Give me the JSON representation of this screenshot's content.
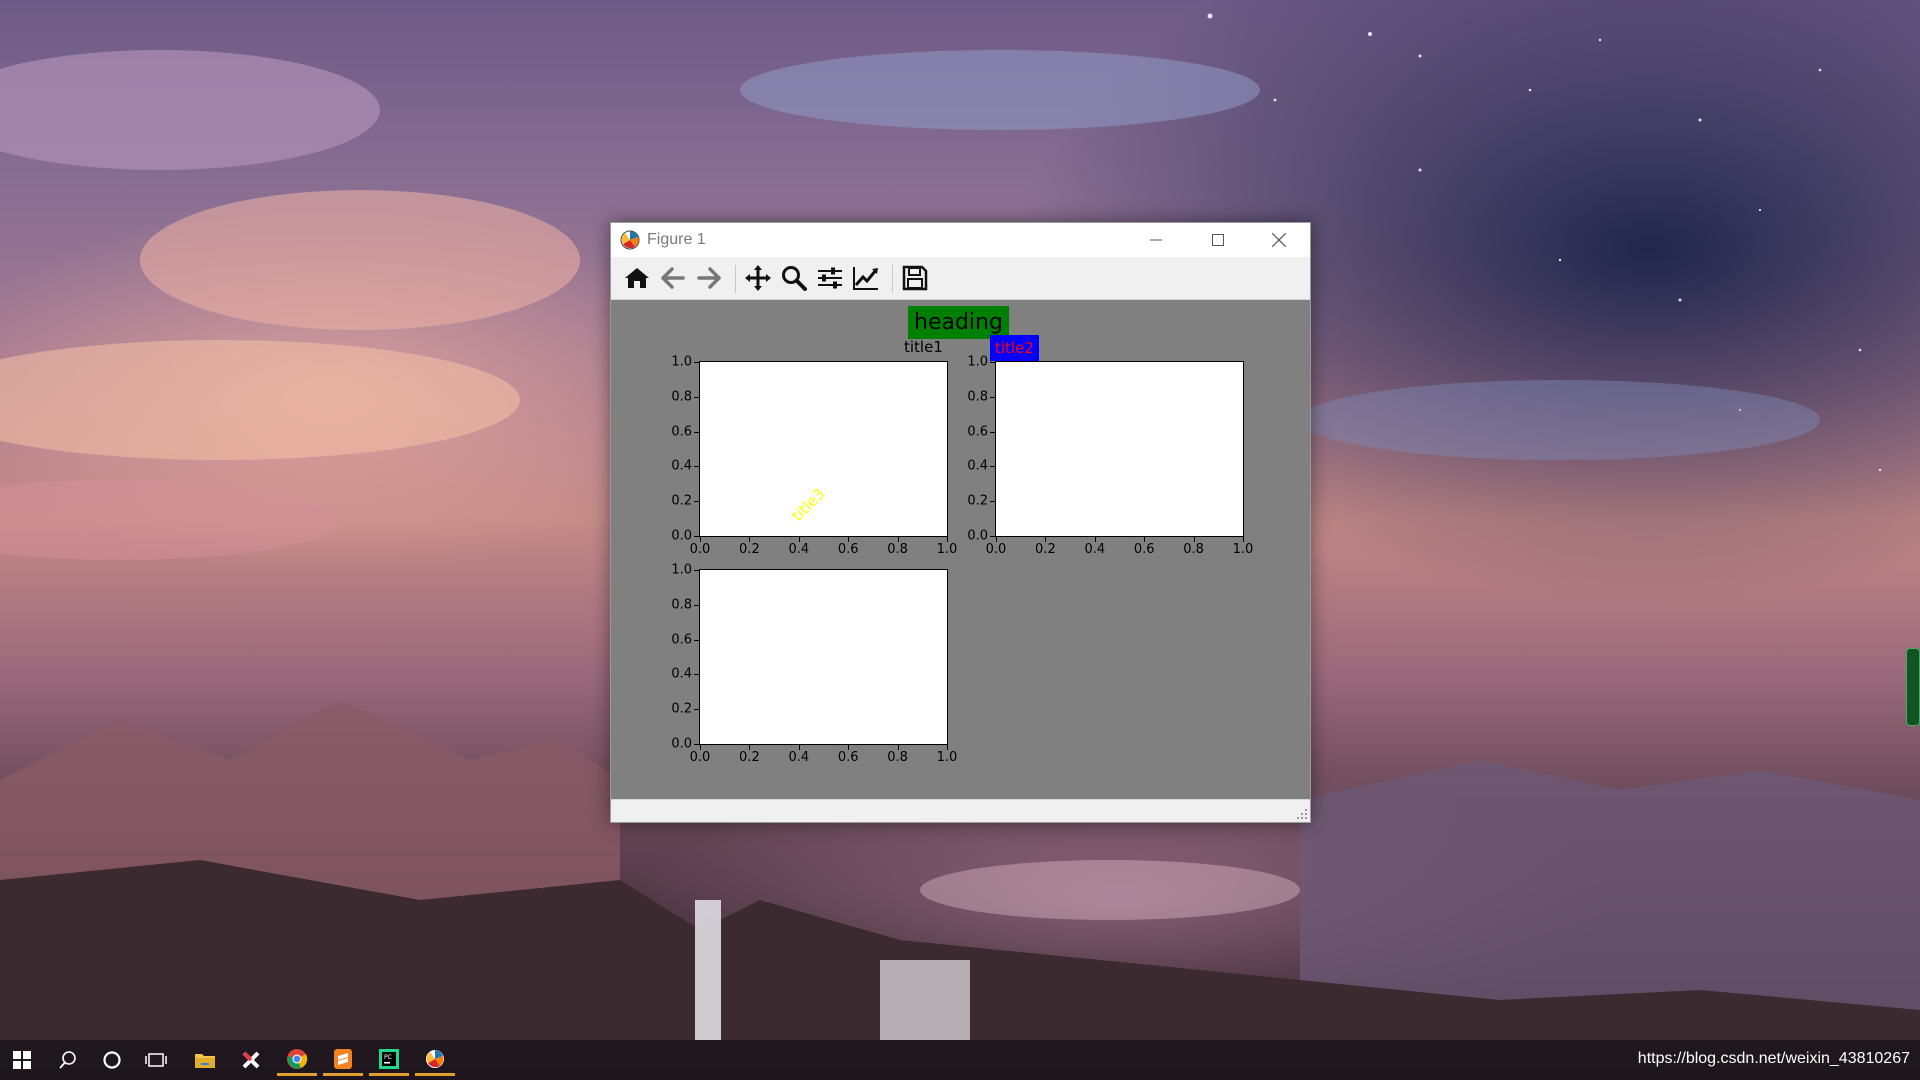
{
  "window": {
    "title": "Figure 1",
    "controls": {
      "minimize": "minimize",
      "maximize": "maximize",
      "close": "close"
    }
  },
  "toolbar": {
    "buttons": [
      {
        "icon": "home-icon"
      },
      {
        "icon": "back-arrow-icon"
      },
      {
        "icon": "forward-arrow-icon"
      },
      {
        "icon": "pan-icon"
      },
      {
        "icon": "zoom-icon"
      },
      {
        "icon": "subplots-config-icon"
      },
      {
        "icon": "edit-axes-icon"
      },
      {
        "icon": "save-icon"
      }
    ]
  },
  "figure": {
    "suptitle": "heading",
    "colors": {
      "background": "#808080",
      "heading_bg": "#008000",
      "title2_bg": "#0000ff",
      "title2_fg": "#ff0000",
      "title3_fg": "#ffff00"
    }
  },
  "chart_data": [
    {
      "type": "scatter",
      "title": "title1",
      "xlim": [
        0.0,
        1.0
      ],
      "ylim": [
        0.0,
        1.0
      ],
      "xticks": [
        "0.0",
        "0.2",
        "0.4",
        "0.6",
        "0.8",
        "1.0"
      ],
      "yticks": [
        "0.0",
        "0.2",
        "0.4",
        "0.6",
        "0.8",
        "1.0"
      ],
      "series": []
    },
    {
      "type": "scatter",
      "title": "title2",
      "xlim": [
        0.0,
        1.0
      ],
      "ylim": [
        0.0,
        1.0
      ],
      "xticks": [
        "0.0",
        "0.2",
        "0.4",
        "0.6",
        "0.8",
        "1.0"
      ],
      "yticks": [
        "0.0",
        "0.2",
        "0.4",
        "0.6",
        "0.8",
        "1.0"
      ],
      "series": []
    },
    {
      "type": "scatter",
      "title": "title3",
      "xlim": [
        0.0,
        1.0
      ],
      "ylim": [
        0.0,
        1.0
      ],
      "xticks": [
        "0.0",
        "0.2",
        "0.4",
        "0.6",
        "0.8",
        "1.0"
      ],
      "yticks": [
        "0.0",
        "0.2",
        "0.4",
        "0.6",
        "0.8",
        "1.0"
      ],
      "series": []
    }
  ],
  "taskbar": {
    "items": [
      {
        "icon": "windows-start-icon"
      },
      {
        "icon": "search-icon"
      },
      {
        "icon": "cortana-icon"
      },
      {
        "icon": "task-view-icon"
      },
      {
        "icon": "file-explorer-icon"
      },
      {
        "icon": "xmind-icon"
      },
      {
        "icon": "chrome-icon"
      },
      {
        "icon": "sublime-icon"
      },
      {
        "icon": "pycharm-icon"
      },
      {
        "icon": "matplotlib-icon"
      }
    ],
    "watermark": "https://blog.csdn.net/weixin_43810267"
  }
}
